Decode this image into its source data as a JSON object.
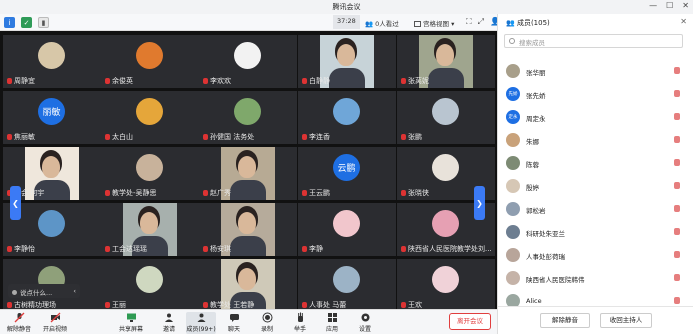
{
  "window": {
    "title": "腾讯会议",
    "controls": [
      "—",
      "☐",
      "✕"
    ]
  },
  "topbar": {
    "time": "37:28",
    "watching": "0人看过",
    "view": "宫格视图"
  },
  "grid": {
    "tiles": [
      {
        "name": "周静宜",
        "kind": "avatar-doll"
      },
      {
        "name": "余俊英",
        "kind": "avatar-ball"
      },
      {
        "name": "李欢欢",
        "kind": "avatar-white"
      },
      {
        "name": "白静静",
        "kind": "video-woman"
      },
      {
        "name": "张莴妮",
        "kind": "video-woman2"
      },
      {
        "name": "焦丽敏",
        "kind": "avatar-blue",
        "avatar_text": "丽敏"
      },
      {
        "name": "太白山",
        "kind": "avatar-orange"
      },
      {
        "name": "孙健国 法务处",
        "kind": "avatar-tree"
      },
      {
        "name": "李连香",
        "kind": "avatar-sky"
      },
      {
        "name": "张鹏",
        "kind": "avatar-mount"
      },
      {
        "name": "工会 何宇",
        "kind": "video-girl"
      },
      {
        "name": "教学处-吴静思",
        "kind": "avatar-kid"
      },
      {
        "name": "赵广秀",
        "kind": "video-woman3"
      },
      {
        "name": "王云鹏",
        "kind": "avatar-blue",
        "avatar_text": "云鹏"
      },
      {
        "name": "张晓侠",
        "kind": "avatar-cat"
      },
      {
        "name": "李静怡",
        "kind": "avatar-sea"
      },
      {
        "name": "工会达瑶瑶",
        "kind": "video-room"
      },
      {
        "name": "杨安琪",
        "kind": "video-woman4"
      },
      {
        "name": "李静",
        "kind": "avatar-pink"
      },
      {
        "name": "陕西省人民医院教学处刘...",
        "kind": "avatar-flower"
      },
      {
        "name": "古树精功理场",
        "kind": "avatar-land"
      },
      {
        "name": "王丽",
        "kind": "avatar-lily"
      },
      {
        "name": "教学处 王若静",
        "kind": "video-woman5"
      },
      {
        "name": "人事处 马蕾",
        "kind": "avatar-bird"
      },
      {
        "name": "王欢",
        "kind": "avatar-cake"
      }
    ],
    "chat_pill": "说点什么..."
  },
  "bottombar": {
    "buttons": [
      "解除静音",
      "开启视频",
      "共享屏幕",
      "邀请",
      "成员(99+)",
      "聊天",
      "录制",
      "举手",
      "应用",
      "设置"
    ],
    "end": "离开会议"
  },
  "panel": {
    "title": "成员(105)",
    "search_placeholder": "搜索成员",
    "members": [
      {
        "name": "张华丽",
        "av": "#a89f8a"
      },
      {
        "name": "张先娇",
        "av": "blue",
        "text": "先娇"
      },
      {
        "name": "周定永",
        "av": "blue",
        "text": "定永"
      },
      {
        "name": "朱娜",
        "av": "#c9a27a"
      },
      {
        "name": "陈蓉",
        "av": "#7d8b74"
      },
      {
        "name": "殷婷",
        "av": "#d6c7b5"
      },
      {
        "name": "郭松岩",
        "av": "#8f9eb0"
      },
      {
        "name": "科研处朱亚兰",
        "av": "#6d7e91"
      },
      {
        "name": "人事处彭荷瑞",
        "av": "#b8a59a"
      },
      {
        "name": "陕西省人民医院韩伟",
        "av": "#c5b3a8"
      },
      {
        "name": "Alice",
        "av": "#9aa7a0"
      }
    ],
    "footer": {
      "unmute_all": "解除静音",
      "reclaim_host": "收回主持人"
    }
  }
}
